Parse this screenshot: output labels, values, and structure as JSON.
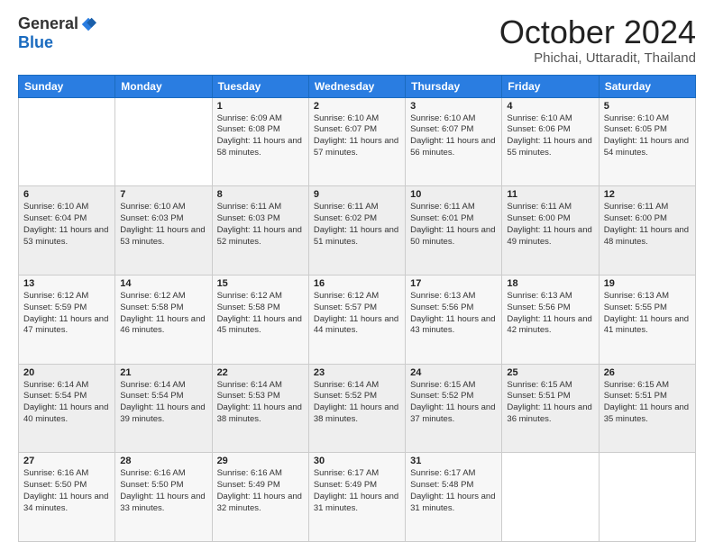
{
  "header": {
    "logo_general": "General",
    "logo_blue": "Blue",
    "month": "October 2024",
    "location": "Phichai, Uttaradit, Thailand"
  },
  "weekdays": [
    "Sunday",
    "Monday",
    "Tuesday",
    "Wednesday",
    "Thursday",
    "Friday",
    "Saturday"
  ],
  "weeks": [
    [
      {
        "day": "",
        "info": ""
      },
      {
        "day": "",
        "info": ""
      },
      {
        "day": "1",
        "info": "Sunrise: 6:09 AM\nSunset: 6:08 PM\nDaylight: 11 hours and 58 minutes."
      },
      {
        "day": "2",
        "info": "Sunrise: 6:10 AM\nSunset: 6:07 PM\nDaylight: 11 hours and 57 minutes."
      },
      {
        "day": "3",
        "info": "Sunrise: 6:10 AM\nSunset: 6:07 PM\nDaylight: 11 hours and 56 minutes."
      },
      {
        "day": "4",
        "info": "Sunrise: 6:10 AM\nSunset: 6:06 PM\nDaylight: 11 hours and 55 minutes."
      },
      {
        "day": "5",
        "info": "Sunrise: 6:10 AM\nSunset: 6:05 PM\nDaylight: 11 hours and 54 minutes."
      }
    ],
    [
      {
        "day": "6",
        "info": "Sunrise: 6:10 AM\nSunset: 6:04 PM\nDaylight: 11 hours and 53 minutes."
      },
      {
        "day": "7",
        "info": "Sunrise: 6:10 AM\nSunset: 6:03 PM\nDaylight: 11 hours and 53 minutes."
      },
      {
        "day": "8",
        "info": "Sunrise: 6:11 AM\nSunset: 6:03 PM\nDaylight: 11 hours and 52 minutes."
      },
      {
        "day": "9",
        "info": "Sunrise: 6:11 AM\nSunset: 6:02 PM\nDaylight: 11 hours and 51 minutes."
      },
      {
        "day": "10",
        "info": "Sunrise: 6:11 AM\nSunset: 6:01 PM\nDaylight: 11 hours and 50 minutes."
      },
      {
        "day": "11",
        "info": "Sunrise: 6:11 AM\nSunset: 6:00 PM\nDaylight: 11 hours and 49 minutes."
      },
      {
        "day": "12",
        "info": "Sunrise: 6:11 AM\nSunset: 6:00 PM\nDaylight: 11 hours and 48 minutes."
      }
    ],
    [
      {
        "day": "13",
        "info": "Sunrise: 6:12 AM\nSunset: 5:59 PM\nDaylight: 11 hours and 47 minutes."
      },
      {
        "day": "14",
        "info": "Sunrise: 6:12 AM\nSunset: 5:58 PM\nDaylight: 11 hours and 46 minutes."
      },
      {
        "day": "15",
        "info": "Sunrise: 6:12 AM\nSunset: 5:58 PM\nDaylight: 11 hours and 45 minutes."
      },
      {
        "day": "16",
        "info": "Sunrise: 6:12 AM\nSunset: 5:57 PM\nDaylight: 11 hours and 44 minutes."
      },
      {
        "day": "17",
        "info": "Sunrise: 6:13 AM\nSunset: 5:56 PM\nDaylight: 11 hours and 43 minutes."
      },
      {
        "day": "18",
        "info": "Sunrise: 6:13 AM\nSunset: 5:56 PM\nDaylight: 11 hours and 42 minutes."
      },
      {
        "day": "19",
        "info": "Sunrise: 6:13 AM\nSunset: 5:55 PM\nDaylight: 11 hours and 41 minutes."
      }
    ],
    [
      {
        "day": "20",
        "info": "Sunrise: 6:14 AM\nSunset: 5:54 PM\nDaylight: 11 hours and 40 minutes."
      },
      {
        "day": "21",
        "info": "Sunrise: 6:14 AM\nSunset: 5:54 PM\nDaylight: 11 hours and 39 minutes."
      },
      {
        "day": "22",
        "info": "Sunrise: 6:14 AM\nSunset: 5:53 PM\nDaylight: 11 hours and 38 minutes."
      },
      {
        "day": "23",
        "info": "Sunrise: 6:14 AM\nSunset: 5:52 PM\nDaylight: 11 hours and 38 minutes."
      },
      {
        "day": "24",
        "info": "Sunrise: 6:15 AM\nSunset: 5:52 PM\nDaylight: 11 hours and 37 minutes."
      },
      {
        "day": "25",
        "info": "Sunrise: 6:15 AM\nSunset: 5:51 PM\nDaylight: 11 hours and 36 minutes."
      },
      {
        "day": "26",
        "info": "Sunrise: 6:15 AM\nSunset: 5:51 PM\nDaylight: 11 hours and 35 minutes."
      }
    ],
    [
      {
        "day": "27",
        "info": "Sunrise: 6:16 AM\nSunset: 5:50 PM\nDaylight: 11 hours and 34 minutes."
      },
      {
        "day": "28",
        "info": "Sunrise: 6:16 AM\nSunset: 5:50 PM\nDaylight: 11 hours and 33 minutes."
      },
      {
        "day": "29",
        "info": "Sunrise: 6:16 AM\nSunset: 5:49 PM\nDaylight: 11 hours and 32 minutes."
      },
      {
        "day": "30",
        "info": "Sunrise: 6:17 AM\nSunset: 5:49 PM\nDaylight: 11 hours and 31 minutes."
      },
      {
        "day": "31",
        "info": "Sunrise: 6:17 AM\nSunset: 5:48 PM\nDaylight: 11 hours and 31 minutes."
      },
      {
        "day": "",
        "info": ""
      },
      {
        "day": "",
        "info": ""
      }
    ]
  ]
}
